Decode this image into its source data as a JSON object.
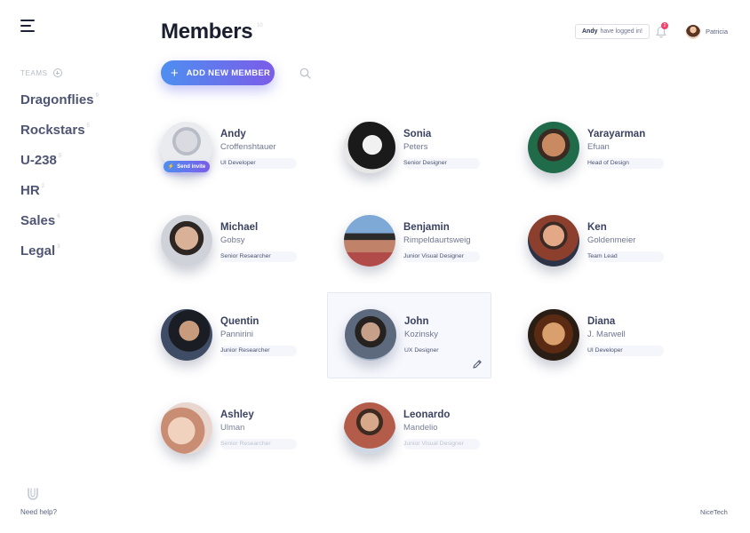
{
  "sidebar": {
    "teams_label": "TEAMS",
    "teams": [
      {
        "name": "Dragonflies",
        "count": "9"
      },
      {
        "name": "Rockstars",
        "count": "5"
      },
      {
        "name": "U-238",
        "count": "5"
      },
      {
        "name": "HR",
        "count": "2"
      },
      {
        "name": "Sales",
        "count": "6"
      },
      {
        "name": "Legal",
        "count": "3"
      }
    ],
    "help_label": "Need help?"
  },
  "header": {
    "title": "Members",
    "title_count": "10",
    "add_button_label": "ADD NEW MEMBER",
    "notice_user": "Andy",
    "notice_text": "have logged in!",
    "notification_count": "2",
    "user_name": "Patricia"
  },
  "members": [
    {
      "first": "Andy",
      "last": "Croffenshtauer",
      "role": "UI Developer",
      "invite": "Send invite"
    },
    {
      "first": "Sonia",
      "last": "Peters",
      "role": "Senior Designer"
    },
    {
      "first": "Yarayarman",
      "last": "Efuan",
      "role": "Head of Design"
    },
    {
      "first": "Michael",
      "last": "Gobsy",
      "role": "Senior Researcher"
    },
    {
      "first": "Benjamin",
      "last": "Rimpeldaurtsweig",
      "role": "Junior Visual Designer"
    },
    {
      "first": "Ken",
      "last": "Goldenmeier",
      "role": "Team Lead"
    },
    {
      "first": "Quentin",
      "last": "Pannirini",
      "role": "Junior Researcher"
    },
    {
      "first": "John",
      "last": "Kozinsky",
      "role": "UX Designer"
    },
    {
      "first": "Diana",
      "last": "J. Marwell",
      "role": "UI Developer"
    },
    {
      "first": "Ashley",
      "last": "Ulman",
      "role": "Senior Researcher"
    },
    {
      "first": "Leonardo",
      "last": "Mandelio",
      "role": "Junior Visual Designer"
    }
  ],
  "footer": {
    "brand": "NiceTech"
  },
  "colors": {
    "accent_start": "#4e8ff0",
    "accent_end": "#7b5ce8",
    "badge": "#f0436b"
  }
}
